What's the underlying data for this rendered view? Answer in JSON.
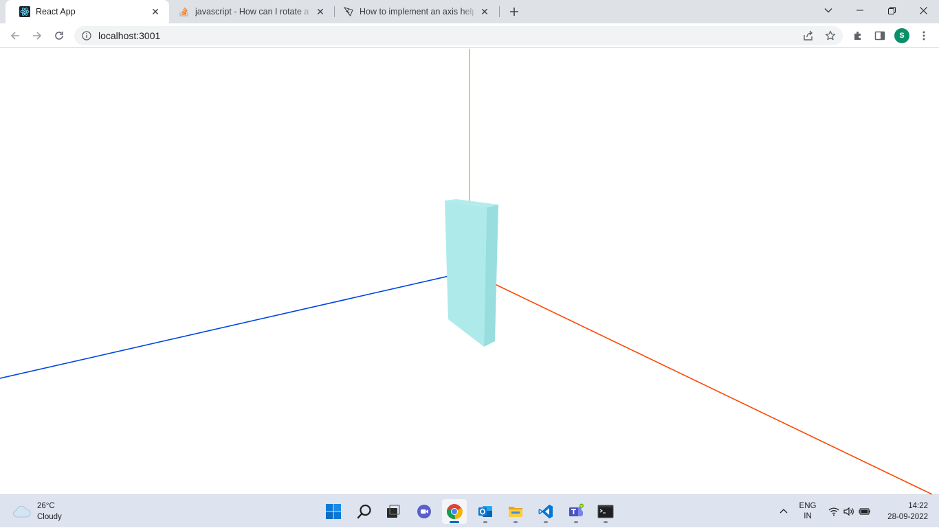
{
  "browser": {
    "tabs": [
      {
        "title": "React App",
        "icon": "react-icon",
        "active": true
      },
      {
        "title": "javascript - How can I rotate a me",
        "icon": "stackoverflow-icon",
        "active": false
      },
      {
        "title": "How to implement an axis helper",
        "icon": "threejs-icon",
        "active": false
      }
    ],
    "url": "localhost:3001",
    "profile_initial": "S"
  },
  "scene": {
    "axis_colors": {
      "x": "#ff4500",
      "y": "#7cfc00",
      "z": "#0047e0"
    },
    "box_colors": {
      "front": "#aeeaea",
      "side": "#98dede",
      "top": "#b4ecec"
    }
  },
  "taskbar": {
    "weather": {
      "temp": "26°C",
      "condition": "Cloudy"
    },
    "apps": [
      {
        "name": "windows-start-icon"
      },
      {
        "name": "search-icon"
      },
      {
        "name": "task-view-icon"
      },
      {
        "name": "teams-chat-icon"
      },
      {
        "name": "chrome-icon"
      },
      {
        "name": "outlook-icon"
      },
      {
        "name": "file-explorer-icon"
      },
      {
        "name": "vscode-icon"
      },
      {
        "name": "teams-icon"
      },
      {
        "name": "terminal-icon"
      }
    ],
    "lang": {
      "line1": "ENG",
      "line2": "IN"
    },
    "clock": {
      "time": "14:22",
      "date": "28-09-2022"
    }
  }
}
